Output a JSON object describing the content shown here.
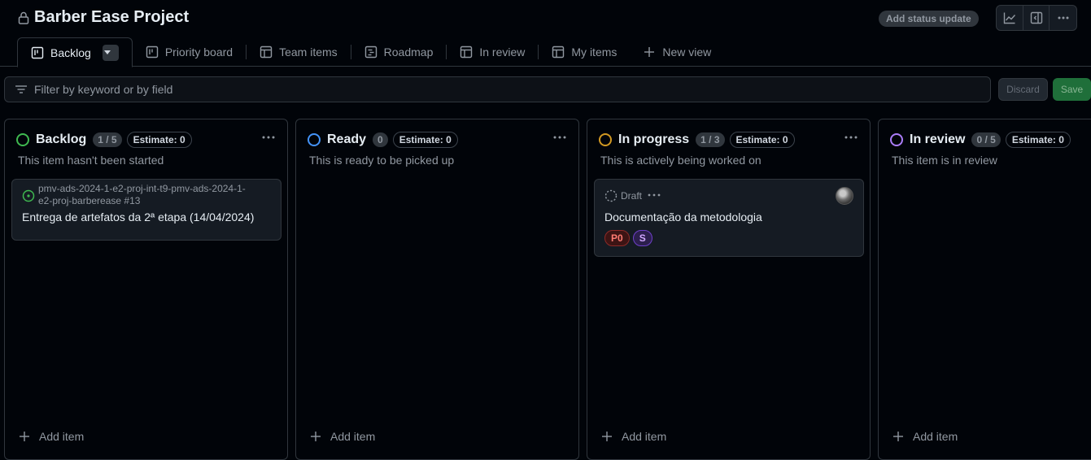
{
  "header": {
    "title": "Barber Ease Project",
    "status_update_label": "Add status update"
  },
  "tabs": [
    {
      "label": "Backlog"
    },
    {
      "label": "Priority board"
    },
    {
      "label": "Team items"
    },
    {
      "label": "Roadmap"
    },
    {
      "label": "In review"
    },
    {
      "label": "My items"
    },
    {
      "label": "New view"
    }
  ],
  "filter": {
    "placeholder": "Filter by keyword or by field",
    "discard_label": "Discard",
    "save_label": "Save"
  },
  "columns": [
    {
      "title": "Backlog",
      "count": "1 / 5",
      "estimate": "Estimate: 0",
      "description": "This item hasn't been started",
      "status_color": "#3fb950",
      "add_label": "Add item",
      "card": {
        "ref": "pmv-ads-2024-1-e2-proj-int-t9-pmv-ads-2024-1-e2-proj-barberease #13",
        "title": "Entrega de artefatos da 2ª etapa (14/04/2024)"
      }
    },
    {
      "title": "Ready",
      "count": "0",
      "estimate": "Estimate: 0",
      "description": "This is ready to be picked up",
      "status_color": "#4493f8",
      "add_label": "Add item"
    },
    {
      "title": "In progress",
      "count": "1 / 3",
      "estimate": "Estimate: 0",
      "description": "This is actively being worked on",
      "status_color": "#d29922",
      "add_label": "Add item",
      "card": {
        "draft_label": "Draft",
        "title": "Documentação da metodologia",
        "labels": [
          "P0",
          "S"
        ]
      }
    },
    {
      "title": "In review",
      "count": "0 / 5",
      "estimate": "Estimate: 0",
      "description": "This item is in review",
      "status_color": "#ab7df8",
      "add_label": "Add item"
    }
  ]
}
